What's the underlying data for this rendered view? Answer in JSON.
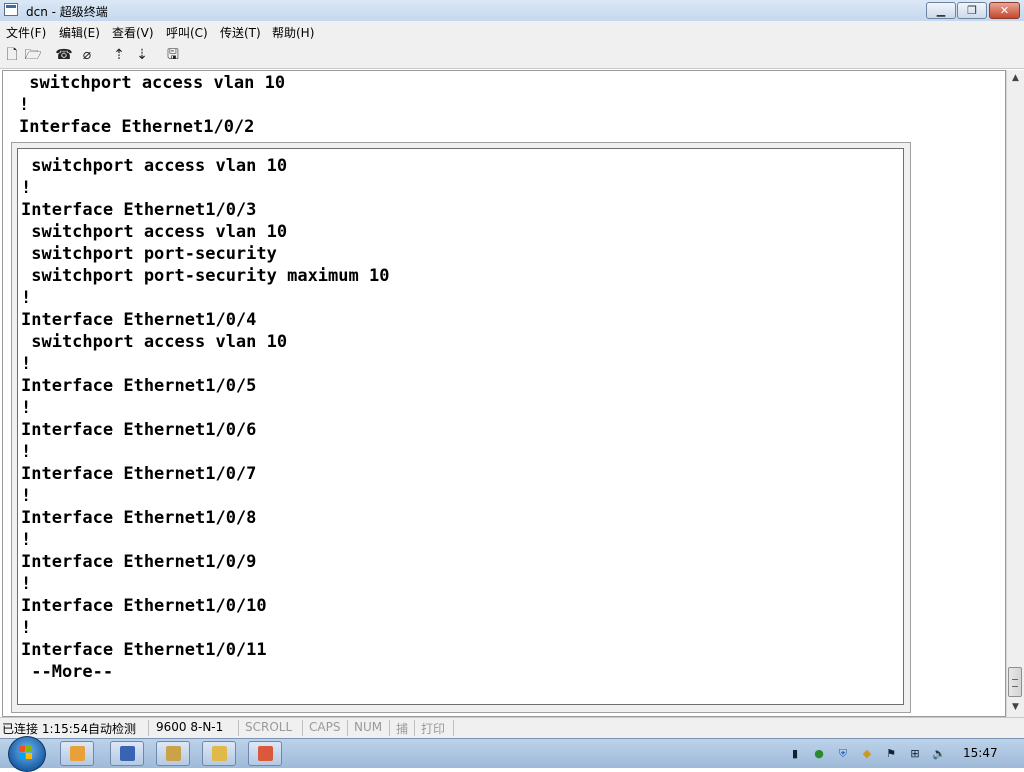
{
  "window": {
    "title": "dcn - 超级终端",
    "min_glyph": "▁",
    "max_glyph": "❐",
    "close_glyph": "✕"
  },
  "menu": {
    "items": [
      "文件(F)",
      "编辑(E)",
      "查看(V)",
      "呼叫(C)",
      "传送(T)",
      "帮助(H)"
    ]
  },
  "toolbar": {
    "icons": [
      "new-file-icon",
      "open-folder-icon",
      "call-icon",
      "disconnect-icon",
      "send-icon",
      "receive-icon",
      "properties-icon"
    ],
    "glyphs": [
      "🗋",
      "🗁",
      "☎",
      "⌀",
      "⇡",
      "⇣",
      "🖫"
    ]
  },
  "terminal": {
    "top_lines": [
      " switchport access vlan 10",
      "!",
      "Interface Ethernet1/0/2"
    ],
    "lines": [
      " switchport access vlan 10",
      "!",
      "Interface Ethernet1/0/3",
      " switchport access vlan 10",
      " switchport port-security",
      " switchport port-security maximum 10",
      "!",
      "Interface Ethernet1/0/4",
      " switchport access vlan 10",
      "!",
      "Interface Ethernet1/0/5",
      "!",
      "Interface Ethernet1/0/6",
      "!",
      "Interface Ethernet1/0/7",
      "!",
      "Interface Ethernet1/0/8",
      "!",
      "Interface Ethernet1/0/9",
      "!",
      "Interface Ethernet1/0/10",
      "!",
      "Interface Ethernet1/0/11",
      " --More--"
    ]
  },
  "scrollbar": {
    "up_glyph": "▲",
    "down_glyph": "▼"
  },
  "status": {
    "connection": "已连接 1:15:54",
    "detect": "自动检测",
    "port_settings": "9600 8-N-1",
    "scroll": "SCROLL",
    "caps": "CAPS",
    "num": "NUM",
    "capture": "捕",
    "print": "打印"
  },
  "taskbar": {
    "apps": [
      "app-1",
      "word-app",
      "file-explorer",
      "app-4",
      "app-5"
    ],
    "app_colors": [
      "#e8a03a",
      "#3b63b4",
      "#c9a24a",
      "#e0b94a",
      "#d9593a"
    ],
    "clock": "15:47"
  },
  "colors": {
    "terminal_text": "#000000",
    "terminal_bg": "#ffffff",
    "titlebar": "#c6d8ee"
  }
}
